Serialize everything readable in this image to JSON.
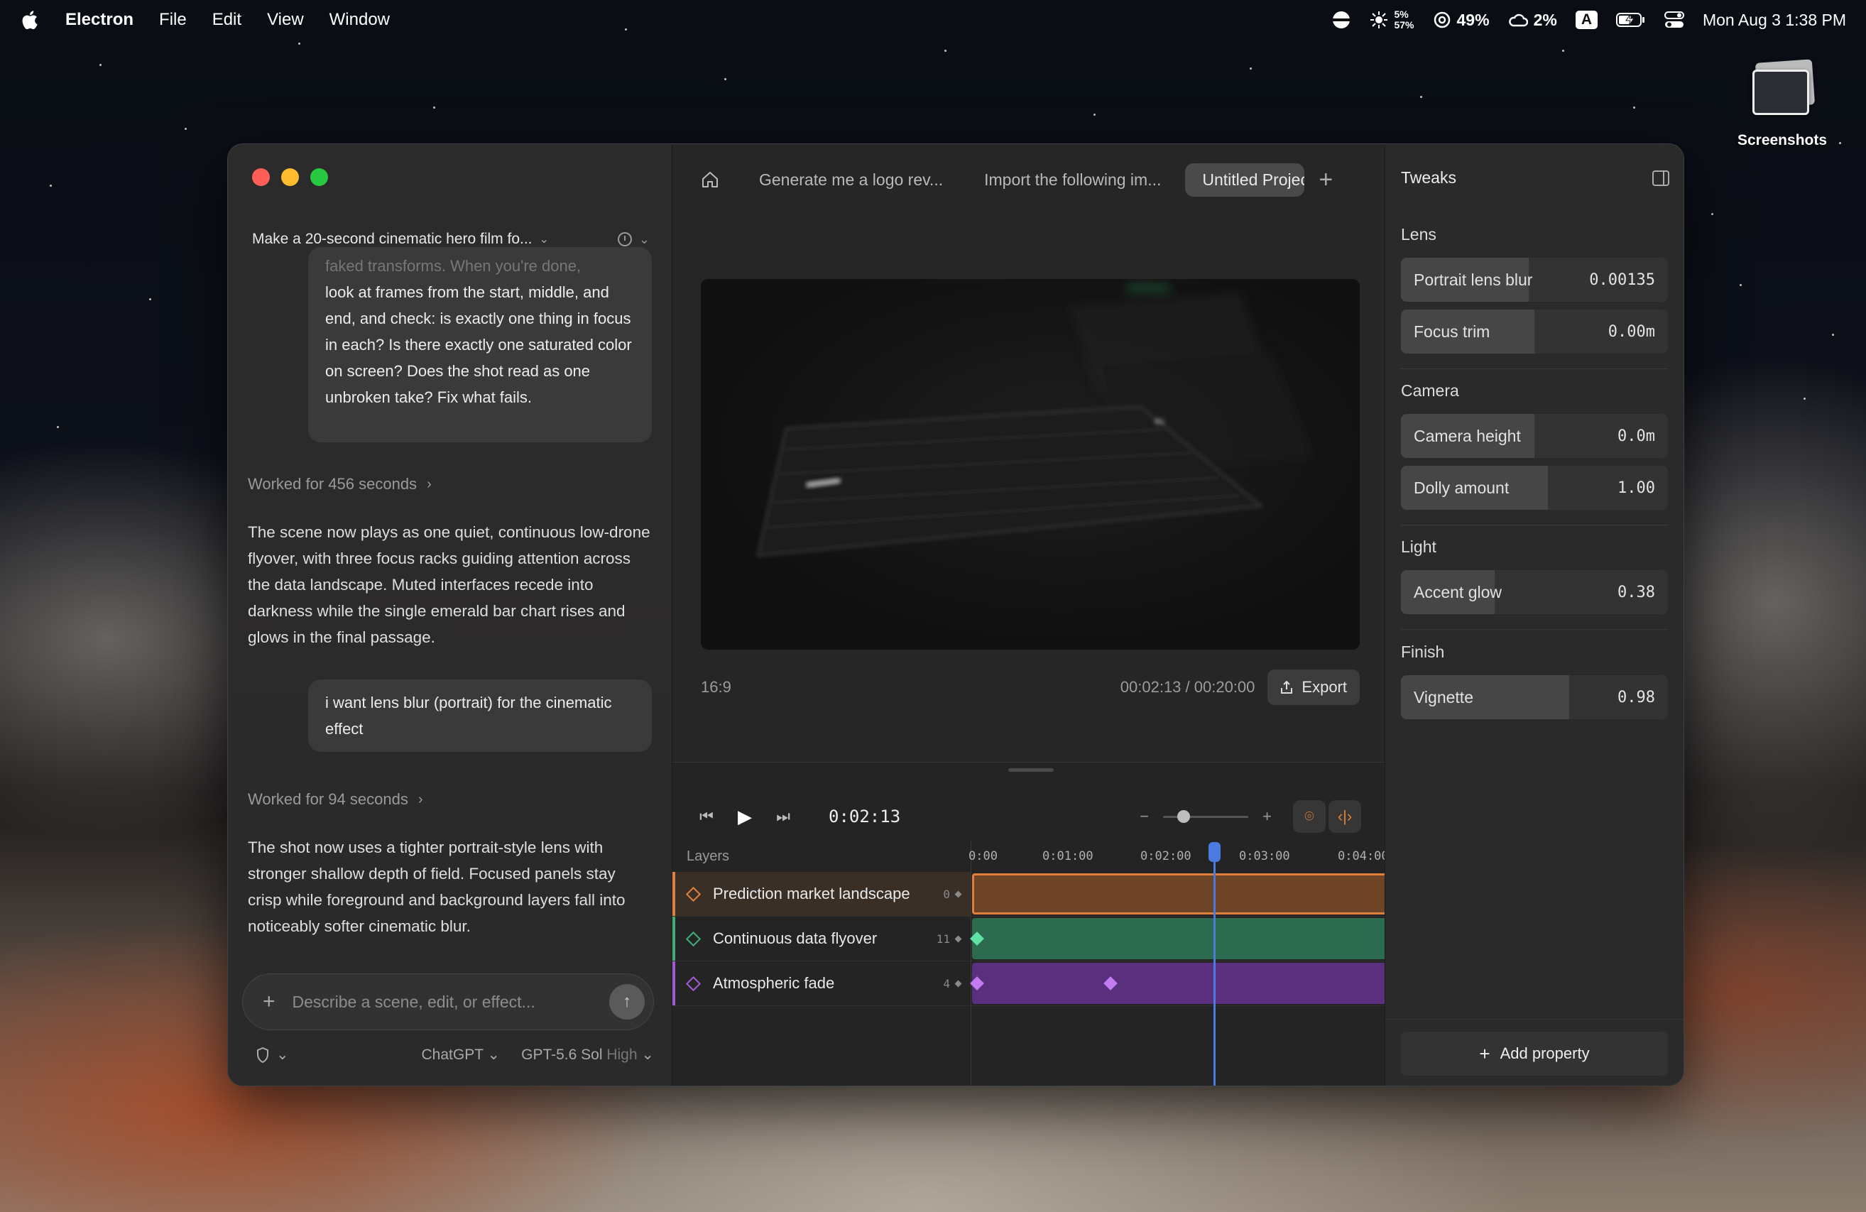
{
  "menubar": {
    "app": "Electron",
    "items": [
      "File",
      "Edit",
      "View",
      "Window"
    ],
    "status": {
      "cpu_top": "5%",
      "cpu_bottom": "57%",
      "battery_stat": "49%",
      "cloud_stat": "2%",
      "input": "A",
      "datetime": "Mon Aug 3  1:38 PM"
    }
  },
  "desktop": {
    "screenshots_label": "Screenshots"
  },
  "chat": {
    "title": "Make a 20-second cinematic hero film fo...",
    "first_bubble": {
      "faded_line": "faked transforms. When you're done,",
      "text": "look at frames from the start, middle, and end, and check: is exactly one thing in focus in each? Is there exactly one saturated color on screen? Does the shot read as one unbroken take? Fix what fails."
    },
    "worked_1": "Worked for 456 seconds",
    "reply_1": "The scene now plays as one quiet, continuous low-drone flyover, with three focus racks guiding attention across the data landscape. Muted interfaces recede into darkness while the single emerald bar chart rises and glows in the final passage.",
    "user_msg": "i want lens blur (portrait) for the cinematic effect",
    "worked_2": "Worked for 94 seconds",
    "reply_2": "The shot now uses a tighter portrait-style lens with stronger shallow depth of field. Focused panels stay crisp while foreground and background layers fall into noticeably softer cinematic blur.",
    "composer_placeholder": "Describe a scene, edit, or effect...",
    "footer": {
      "provider": "ChatGPT",
      "model": "GPT-5.6 Sol",
      "effort": "High"
    }
  },
  "tabs": [
    "Generate me a logo rev...",
    "Import the following im...",
    "Untitled Project"
  ],
  "preview": {
    "aspect": "16:9",
    "time": "00:02:13 / 00:20:00",
    "export_label": "Export",
    "screen_tag": "4%"
  },
  "timeline": {
    "timecode": "0:02:13",
    "layers_label": "Layers",
    "ruler": [
      "0:00",
      "0:01:00",
      "0:02:00",
      "0:03:00",
      "0:04:00"
    ],
    "layers": [
      {
        "name": "Prediction market landscape",
        "keys": "0",
        "color": "#e0803a"
      },
      {
        "name": "Continuous data flyover",
        "keys": "11",
        "color": "#3fae7a"
      },
      {
        "name": "Atmospheric fade",
        "keys": "4",
        "color": "#a45ad6"
      }
    ]
  },
  "tweaks": {
    "title": "Tweaks",
    "sections": {
      "lens": "Lens",
      "camera": "Camera",
      "light": "Light",
      "finish": "Finish"
    },
    "props": {
      "portrait_lens_blur": {
        "label": "Portrait lens blur",
        "value": "0.00135",
        "level": 0.48
      },
      "focus_trim": {
        "label": "Focus trim",
        "value": "0.00m",
        "level": 0.5
      },
      "camera_height": {
        "label": "Camera height",
        "value": "0.0m",
        "level": 0.5
      },
      "dolly_amount": {
        "label": "Dolly amount",
        "value": "1.00",
        "level": 0.55
      },
      "accent_glow": {
        "label": "Accent glow",
        "value": "0.38",
        "level": 0.35
      },
      "vignette": {
        "label": "Vignette",
        "value": "0.98",
        "level": 0.63
      }
    },
    "add_property": "Add property"
  }
}
